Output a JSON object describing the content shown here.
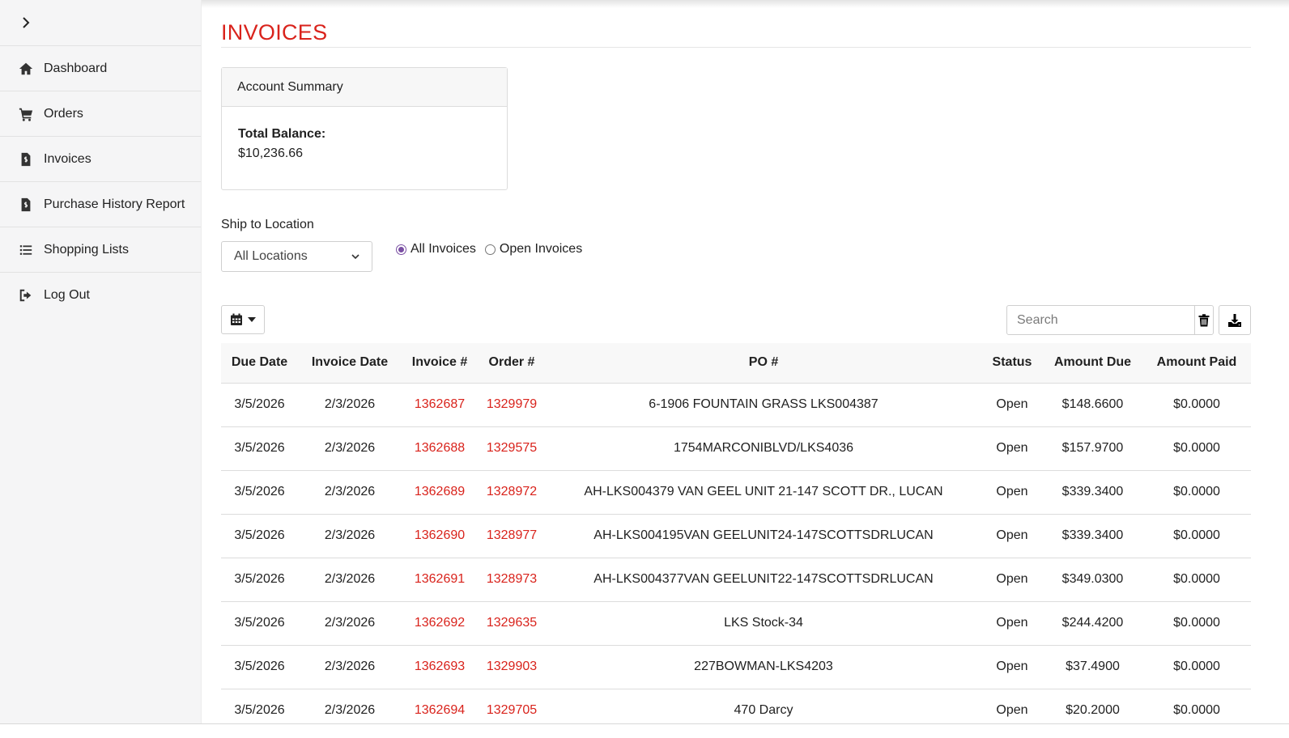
{
  "sidebar": {
    "items": [
      {
        "label": "Dashboard",
        "icon": "home-icon"
      },
      {
        "label": "Orders",
        "icon": "cart-icon"
      },
      {
        "label": "Invoices",
        "icon": "invoice-icon"
      },
      {
        "label": "Purchase History Report",
        "icon": "invoice-icon"
      },
      {
        "label": "Shopping Lists",
        "icon": "list-icon"
      },
      {
        "label": "Log Out",
        "icon": "logout-icon"
      }
    ]
  },
  "page": {
    "title": "INVOICES"
  },
  "summary": {
    "heading": "Account Summary",
    "balance_label": "Total Balance:",
    "balance_value": "$10,236.66"
  },
  "filters": {
    "ship_label": "Ship to Location",
    "ship_value": "All Locations",
    "radio_all": "All Invoices",
    "radio_open": "Open Invoices",
    "selected": "all"
  },
  "search": {
    "placeholder": "Search"
  },
  "colors": {
    "accent": "#d9231c",
    "radio": "#7a4fa3"
  },
  "table": {
    "headers": [
      "Due Date",
      "Invoice Date",
      "Invoice #",
      "Order #",
      "PO #",
      "Status",
      "Amount Due",
      "Amount Paid"
    ],
    "rows": [
      [
        "3/5/2026",
        "2/3/2026",
        "1362687",
        "1329979",
        "6-1906 FOUNTAIN GRASS LKS004387",
        "Open",
        "$148.6600",
        "$0.0000"
      ],
      [
        "3/5/2026",
        "2/3/2026",
        "1362688",
        "1329575",
        "1754MARCONIBLVD/LKS4036",
        "Open",
        "$157.9700",
        "$0.0000"
      ],
      [
        "3/5/2026",
        "2/3/2026",
        "1362689",
        "1328972",
        "AH-LKS004379 VAN GEEL UNIT 21-147 SCOTT DR., LUCAN",
        "Open",
        "$339.3400",
        "$0.0000"
      ],
      [
        "3/5/2026",
        "2/3/2026",
        "1362690",
        "1328977",
        "AH-LKS004195VAN GEELUNIT24-147SCOTTSDRLUCAN",
        "Open",
        "$339.3400",
        "$0.0000"
      ],
      [
        "3/5/2026",
        "2/3/2026",
        "1362691",
        "1328973",
        "AH-LKS004377VAN GEELUNIT22-147SCOTTSDRLUCAN",
        "Open",
        "$349.0300",
        "$0.0000"
      ],
      [
        "3/5/2026",
        "2/3/2026",
        "1362692",
        "1329635",
        "LKS Stock-34",
        "Open",
        "$244.4200",
        "$0.0000"
      ],
      [
        "3/5/2026",
        "2/3/2026",
        "1362693",
        "1329903",
        "227BOWMAN-LKS4203",
        "Open",
        "$37.4900",
        "$0.0000"
      ],
      [
        "3/5/2026",
        "2/3/2026",
        "1362694",
        "1329705",
        "470 Darcy",
        "Open",
        "$20.2000",
        "$0.0000"
      ]
    ]
  }
}
